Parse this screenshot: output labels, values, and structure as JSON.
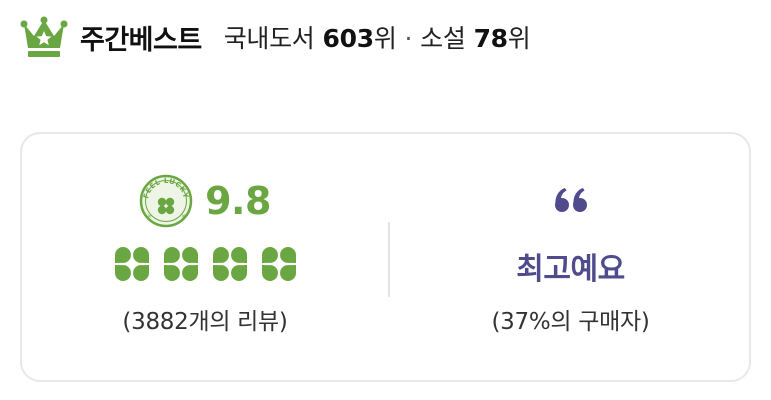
{
  "header": {
    "crown_icon": "crown-star-icon",
    "title": "주간베스트",
    "domestic_label": "국내도서",
    "domestic_rank": "603",
    "rank_suffix_1": "위",
    "separator": "·",
    "novel_label": "소설",
    "novel_rank": "78",
    "rank_suffix_2": "위"
  },
  "review": {
    "badge_icon": "feel-lucky-clover-badge-icon",
    "badge_text": "FEEL LUCKY",
    "score": "9.8",
    "clover_rating": 4,
    "clover_max": 4,
    "count_open": "(",
    "count": "3882",
    "count_suffix": "개의 리뷰)"
  },
  "opinion": {
    "quote_icon": "quote-icon",
    "text": "최고예요",
    "share_text": "(37%의 구매자)"
  },
  "colors": {
    "accent_green": "#6aa641",
    "opinion_purple": "#4f4b8c",
    "border": "#e8e8e8"
  }
}
